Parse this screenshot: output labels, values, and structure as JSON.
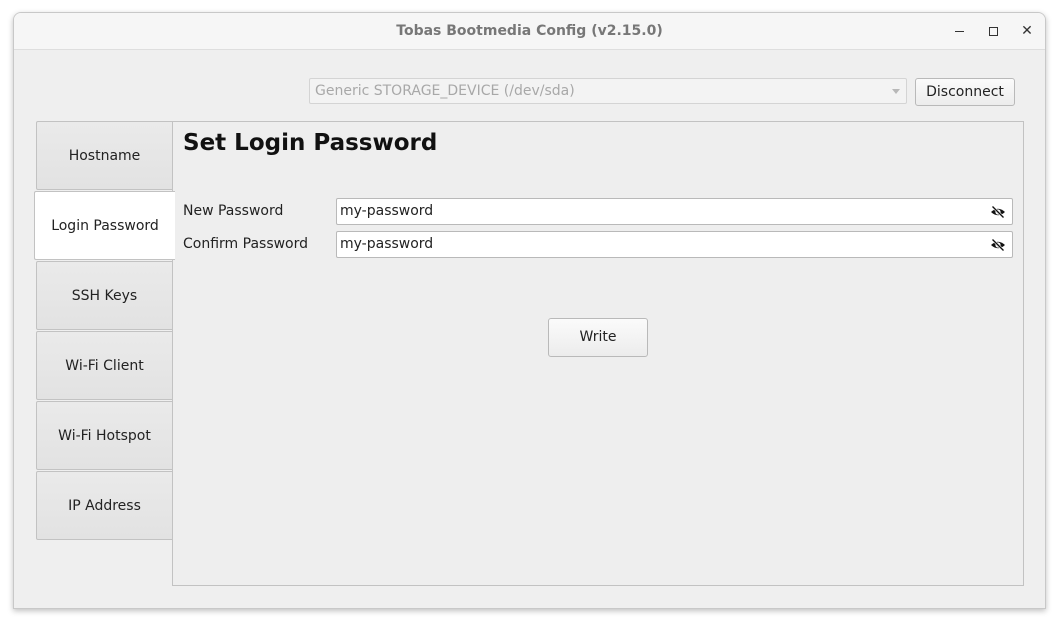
{
  "window": {
    "title": "Tobas Bootmedia Config (v2.15.0)"
  },
  "device": {
    "selected": "Generic STORAGE_DEVICE (/dev/sda)",
    "disconnect_label": "Disconnect"
  },
  "tabs": [
    {
      "label": "Hostname"
    },
    {
      "label": "Login Password"
    },
    {
      "label": "SSH Keys"
    },
    {
      "label": "Wi-Fi Client"
    },
    {
      "label": "Wi-Fi Hotspot"
    },
    {
      "label": "IP Address"
    }
  ],
  "active_tab": "Login Password",
  "panel": {
    "heading": "Set Login Password",
    "new_password_label": "New Password",
    "new_password_value": "my-password",
    "confirm_password_label": "Confirm Password",
    "confirm_password_value": "my-password",
    "write_label": "Write"
  },
  "icons": {
    "visibility_toggle": "eye-slash-icon",
    "dropdown": "chevron-down-icon"
  }
}
